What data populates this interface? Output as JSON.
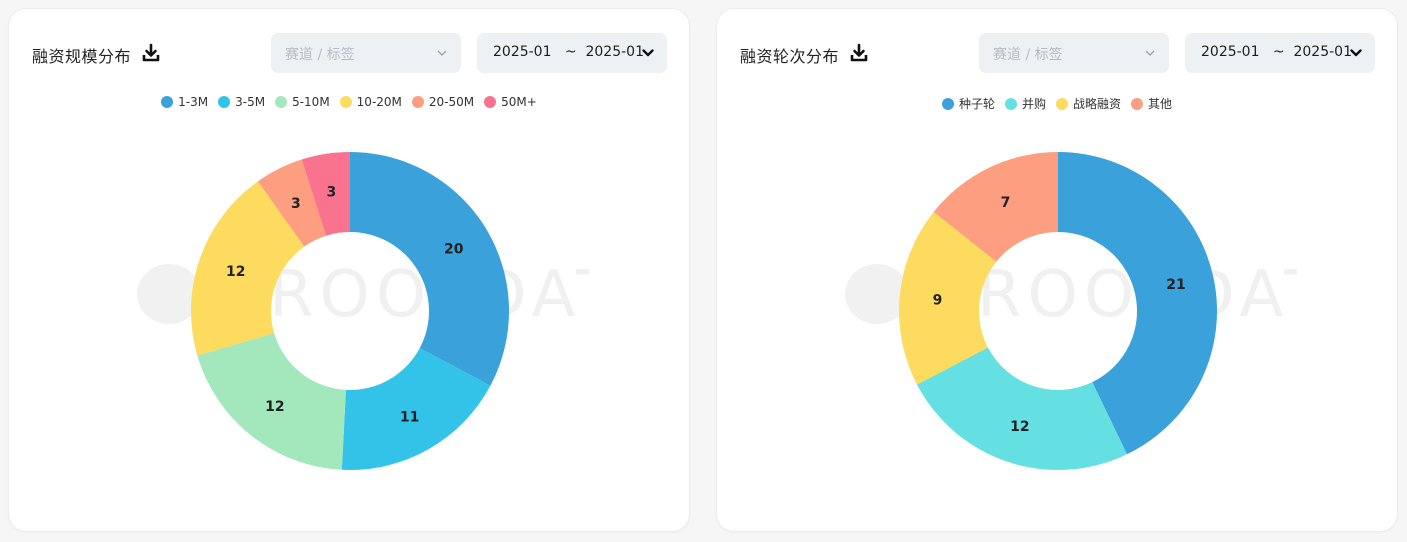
{
  "panels": [
    {
      "id": "scale",
      "title": "融资规模分布",
      "download_icon": "download-icon",
      "track_select": {
        "placeholder": "赛道 / 标签",
        "icon": "chevron-down-icon"
      },
      "date_select": {
        "value": "2025-01   ~  2025-01",
        "icon": "chevron-down-icon"
      }
    },
    {
      "id": "round",
      "title": "融资轮次分布",
      "download_icon": "download-icon",
      "track_select": {
        "placeholder": "赛道 / 标签",
        "icon": "chevron-down-icon"
      },
      "date_select": {
        "value": "2025-01   ~  2025-01",
        "icon": "chevron-down-icon"
      }
    }
  ],
  "watermark": "ROOTDATA",
  "chart_data": [
    {
      "type": "pie",
      "variant": "donut",
      "title": "融资规模分布",
      "legend_position": "top-center",
      "categories": [
        "1-3M",
        "3-5M",
        "5-10M",
        "10-20M",
        "20-50M",
        "50M+"
      ],
      "values": [
        20,
        11,
        12,
        12,
        3,
        3
      ],
      "colors": [
        "#3aa1da",
        "#33c3e8",
        "#a2e8bc",
        "#fcdb5e",
        "#fc9e7f",
        "#f9738f"
      ],
      "show_labels": true
    },
    {
      "type": "pie",
      "variant": "donut",
      "title": "融资轮次分布",
      "legend_position": "top-center",
      "categories": [
        "种子轮",
        "并购",
        "战略融资",
        "其他"
      ],
      "values": [
        21,
        12,
        9,
        7
      ],
      "colors": [
        "#3aa1da",
        "#64dfe2",
        "#fcdb5e",
        "#fc9e7f"
      ],
      "show_labels": true
    }
  ]
}
